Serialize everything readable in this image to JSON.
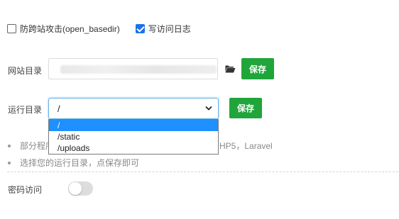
{
  "options": {
    "anti_xss": {
      "label": "防跨站攻击(open_basedir)",
      "checked": false
    },
    "access_log": {
      "label": "写访问日志",
      "checked": true
    }
  },
  "site_dir": {
    "label": "网站目录",
    "value": "",
    "folder_icon": "folder-open-icon",
    "save_label": "保存"
  },
  "run_dir": {
    "label": "运行目录",
    "selected": "/",
    "options": [
      "/",
      "/static",
      "/uploads"
    ],
    "save_label": "保存"
  },
  "tips": {
    "line1_prefix": "部分程序",
    "line1_suffix": "HP5，Laravel",
    "line2": "选择您的运行目录，点保存即可"
  },
  "password_access": {
    "label": "密码访问",
    "enabled": false
  },
  "colors": {
    "accent_green": "#20a53a",
    "select_blue": "#1e90ff",
    "checkbox_blue": "#1a73e8"
  }
}
